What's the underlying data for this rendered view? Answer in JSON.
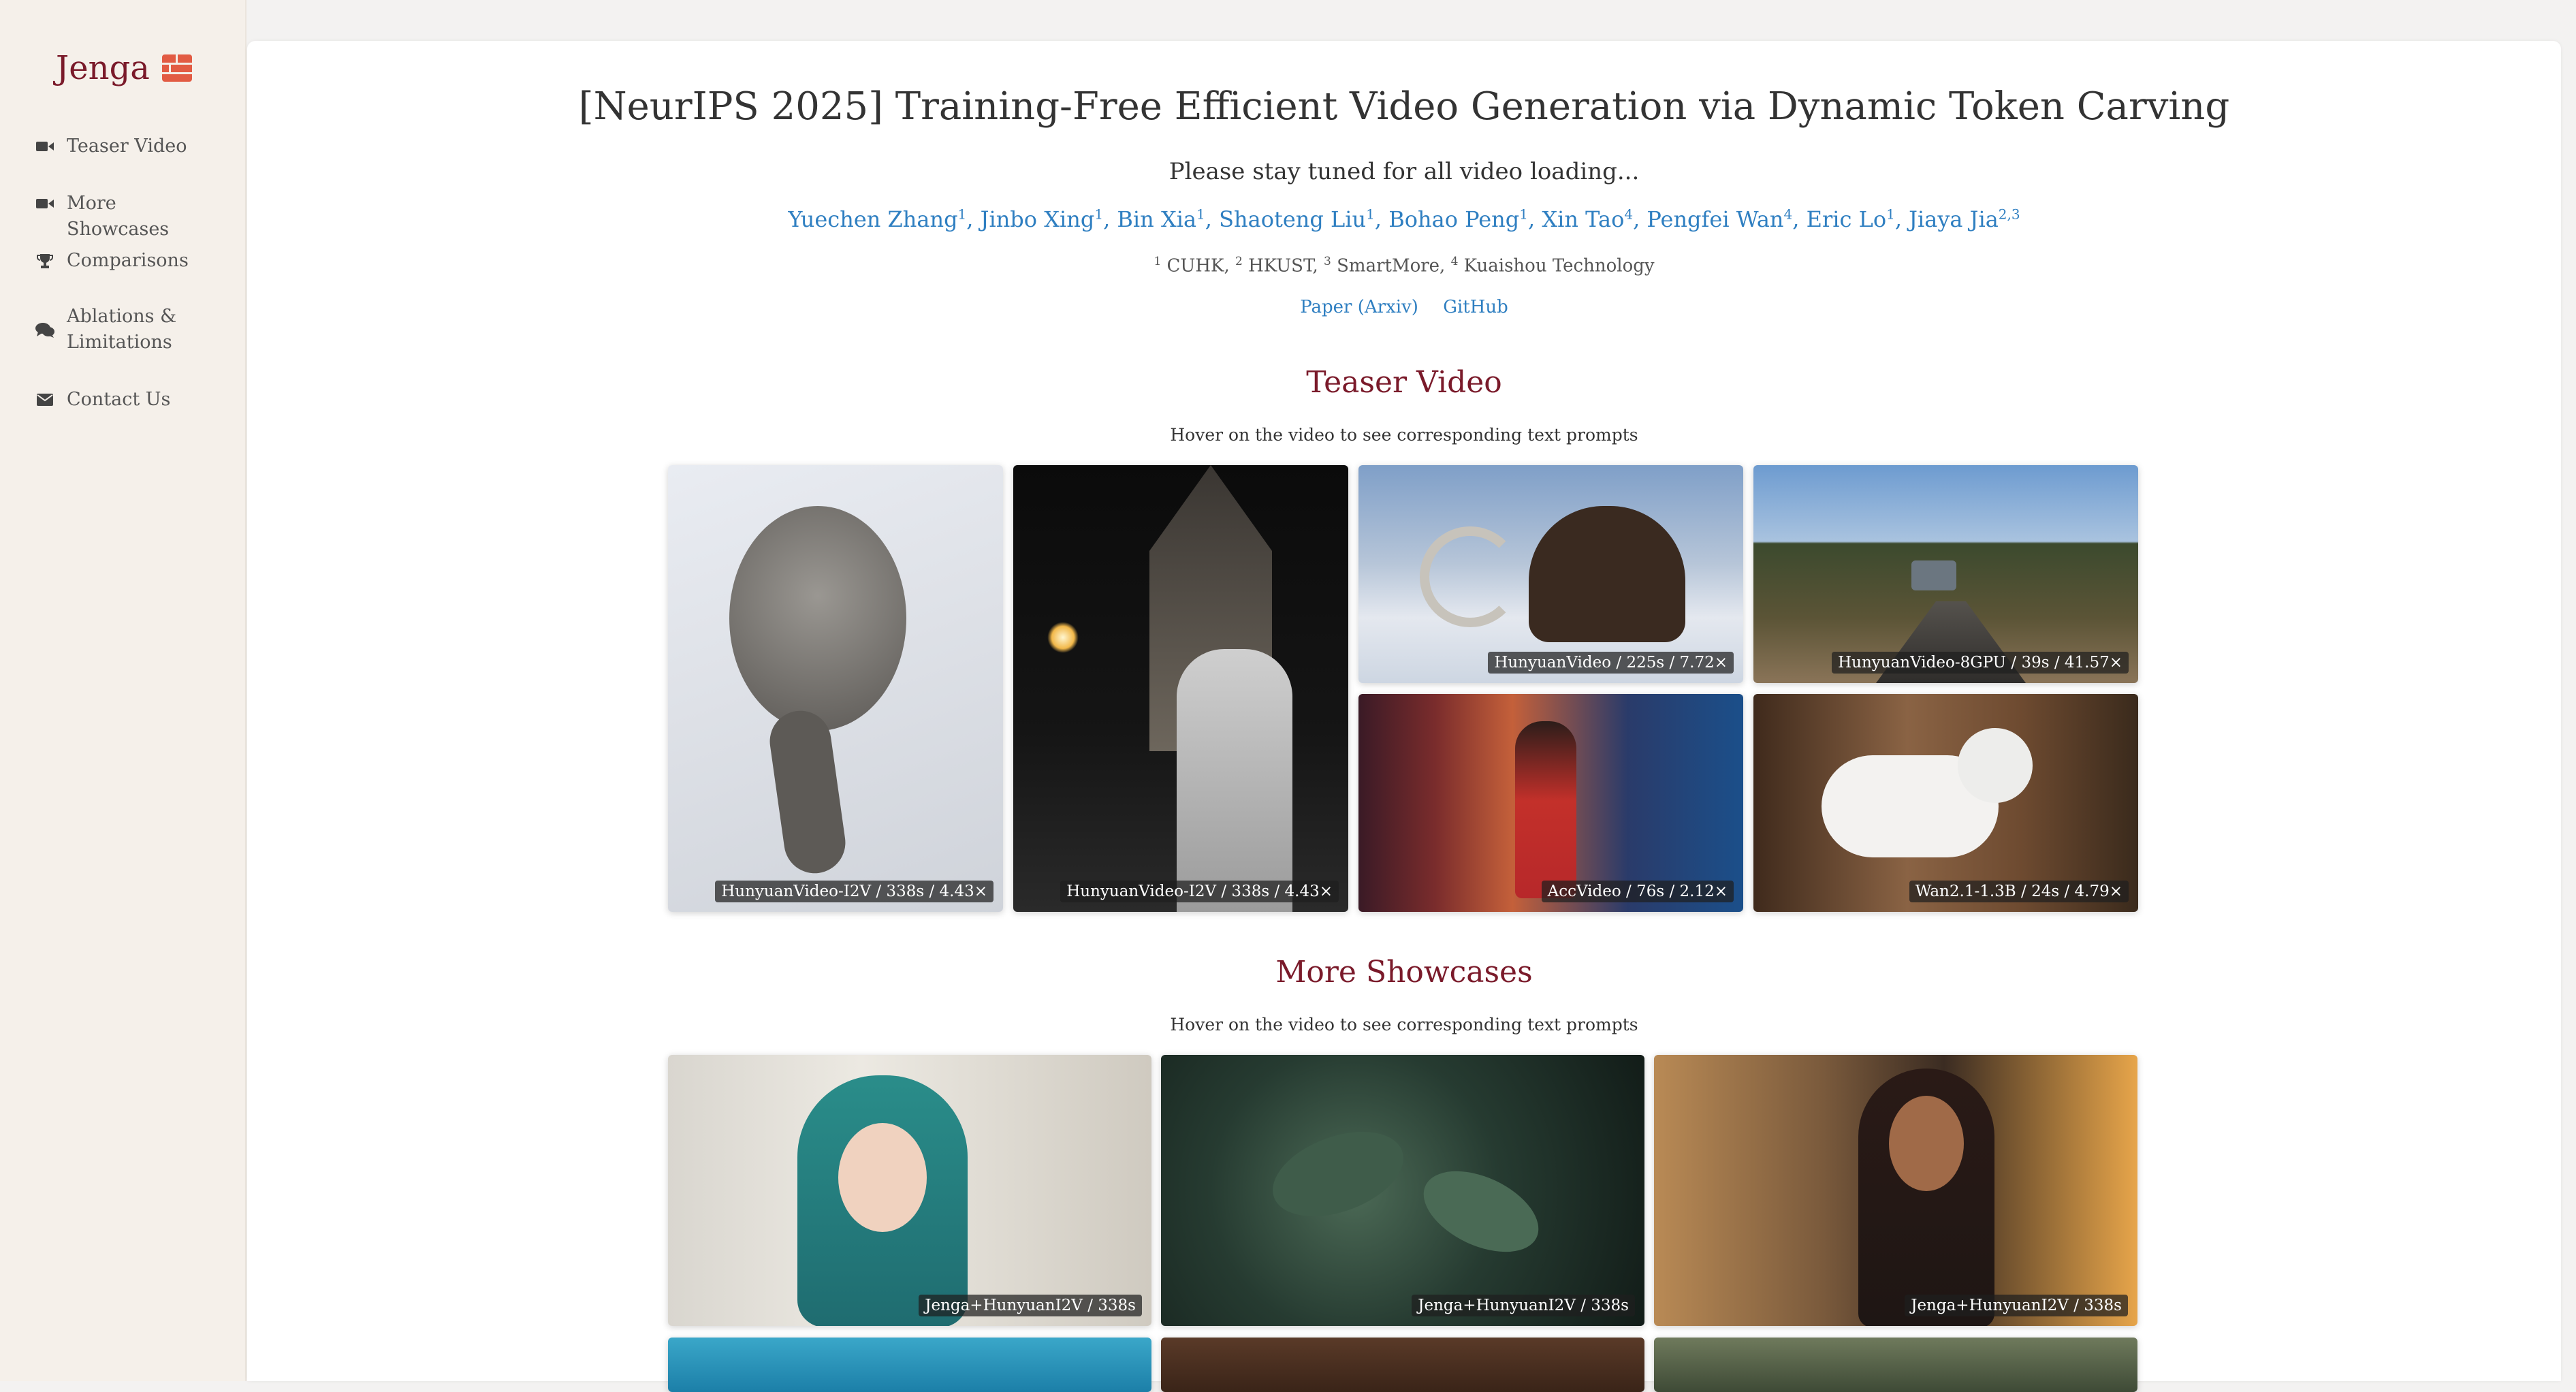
{
  "sidebar": {
    "brand": "Jenga",
    "brand_icon": "brick-icon",
    "items": [
      {
        "label": "Teaser Video",
        "icon": "video-camera-icon"
      },
      {
        "label": "More Showcases",
        "icon": "video-camera-icon"
      },
      {
        "label": "Comparisons",
        "icon": "trophy-icon"
      },
      {
        "label": "Ablations & Limitations",
        "icon": "comments-icon"
      },
      {
        "label": "Contact Us",
        "icon": "envelope-icon"
      }
    ]
  },
  "header": {
    "title": "[NeurIPS 2025] Training-Free Efficient Video Generation via Dynamic Token Carving",
    "notice": "Please stay tuned for all video loading...",
    "authors": [
      {
        "name": "Yuechen Zhang",
        "aff": "1"
      },
      {
        "name": "Jinbo Xing",
        "aff": "1"
      },
      {
        "name": "Bin Xia",
        "aff": "1"
      },
      {
        "name": "Shaoteng Liu",
        "aff": "1"
      },
      {
        "name": "Bohao Peng",
        "aff": "1"
      },
      {
        "name": "Xin Tao",
        "aff": "4"
      },
      {
        "name": "Pengfei Wan",
        "aff": "4"
      },
      {
        "name": "Eric Lo",
        "aff": "1"
      },
      {
        "name": "Jiaya Jia",
        "aff": "2,3"
      }
    ],
    "affiliations": [
      {
        "num": "1",
        "name": "CUHK"
      },
      {
        "num": "2",
        "name": "HKUST"
      },
      {
        "num": "3",
        "name": "SmartMore"
      },
      {
        "num": "4",
        "name": "Kuaishou Technology"
      }
    ],
    "links": [
      "Paper (Arxiv)",
      "GitHub"
    ]
  },
  "teaser": {
    "title": "Teaser Video",
    "subtitle": "Hover on the video to see corresponding text prompts",
    "videos": [
      {
        "caption": "HunyuanVideo-I2V / 338s / 4.43×"
      },
      {
        "caption": "HunyuanVideo-I2V / 338s / 4.43×"
      },
      {
        "caption": "HunyuanVideo / 225s / 7.72×"
      },
      {
        "caption": "HunyuanVideo-8GPU / 39s / 41.57×"
      },
      {
        "caption": "AccVideo / 76s / 2.12×"
      },
      {
        "caption": "Wan2.1-1.3B / 24s / 4.79×"
      }
    ]
  },
  "showcases": {
    "title": "More Showcases",
    "subtitle": "Hover on the video to see corresponding text prompts",
    "videos": [
      {
        "caption": "Jenga+HunyuanI2V / 338s"
      },
      {
        "caption": "Jenga+HunyuanI2V / 338s"
      },
      {
        "caption": "Jenga+HunyuanI2V / 338s"
      },
      {
        "caption": ""
      },
      {
        "caption": ""
      },
      {
        "caption": ""
      }
    ]
  },
  "colors": {
    "accent": "#7a1a2a",
    "link": "#2f7fc1",
    "sidebar_bg": "#f5f0ea"
  }
}
